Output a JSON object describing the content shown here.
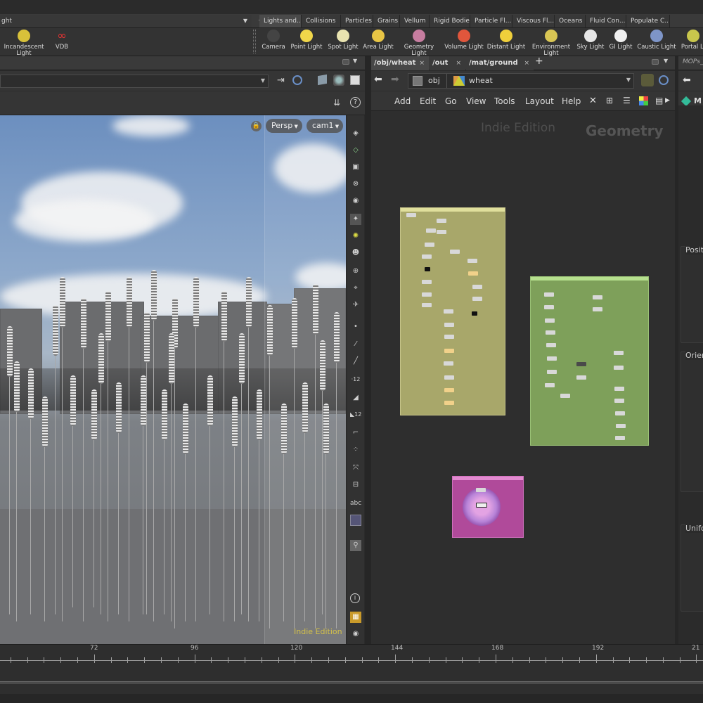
{
  "shelf": {
    "left_tab_label": "ght",
    "right_tabs": [
      {
        "label": "Lights and...",
        "active": true
      },
      {
        "label": "Collisions"
      },
      {
        "label": "Particles"
      },
      {
        "label": "Grains"
      },
      {
        "label": "Vellum"
      },
      {
        "label": "Rigid Bodies"
      },
      {
        "label": "Particle Fl..."
      },
      {
        "label": "Viscous Fl..."
      },
      {
        "label": "Oceans"
      },
      {
        "label": "Fluid Con..."
      },
      {
        "label": "Populate C..."
      }
    ],
    "left_tools": [
      {
        "label": "Incandescent Light",
        "icon": "incandescent-light-icon"
      },
      {
        "label": "VDB",
        "icon": "vdb-icon"
      }
    ],
    "right_tools": [
      {
        "label": "Camera",
        "icon": "camera-icon"
      },
      {
        "label": "Point Light",
        "icon": "point-light-icon"
      },
      {
        "label": "Spot Light",
        "icon": "spot-light-icon"
      },
      {
        "label": "Area Light",
        "icon": "area-light-icon"
      },
      {
        "label": "Geometry Light",
        "icon": "geometry-light-icon"
      },
      {
        "label": "Volume Light",
        "icon": "volume-light-icon"
      },
      {
        "label": "Distant Light",
        "icon": "distant-light-icon"
      },
      {
        "label": "Environment Light",
        "icon": "environment-light-icon"
      },
      {
        "label": "Sky Light",
        "icon": "sky-light-icon"
      },
      {
        "label": "GI Light",
        "icon": "gi-light-icon"
      },
      {
        "label": "Caustic Light",
        "icon": "caustic-light-icon"
      },
      {
        "label": "Portal Li",
        "icon": "portal-light-icon"
      }
    ]
  },
  "viewport": {
    "camera_menu": "Persp",
    "cam_menu": "cam1",
    "watermark": "Indie Edition",
    "tools": [
      "abc"
    ]
  },
  "network": {
    "tabs": [
      {
        "label": "/obj/wheat",
        "active": true
      },
      {
        "label": "/out"
      },
      {
        "label": "/mat/ground"
      }
    ],
    "path": [
      "obj",
      "wheat"
    ],
    "menu": [
      "Add",
      "Edit",
      "Go",
      "View",
      "Tools",
      "Layout",
      "Help"
    ],
    "watermark": "Indie Edition",
    "context_label": "Geometry"
  },
  "params": {
    "tab_label": "MOPs_",
    "node_label": "M",
    "sections": [
      "Positi",
      "Orien",
      "Unifo"
    ]
  },
  "timeline": {
    "ticks": [
      "72",
      "96",
      "120",
      "144",
      "168",
      "192",
      "21"
    ]
  },
  "colors": {
    "yellow_box": "#a8a76a",
    "green_box": "#7ea05a",
    "pink_box": "#b04a9a",
    "watermark_yellow": "#d4c14a"
  }
}
